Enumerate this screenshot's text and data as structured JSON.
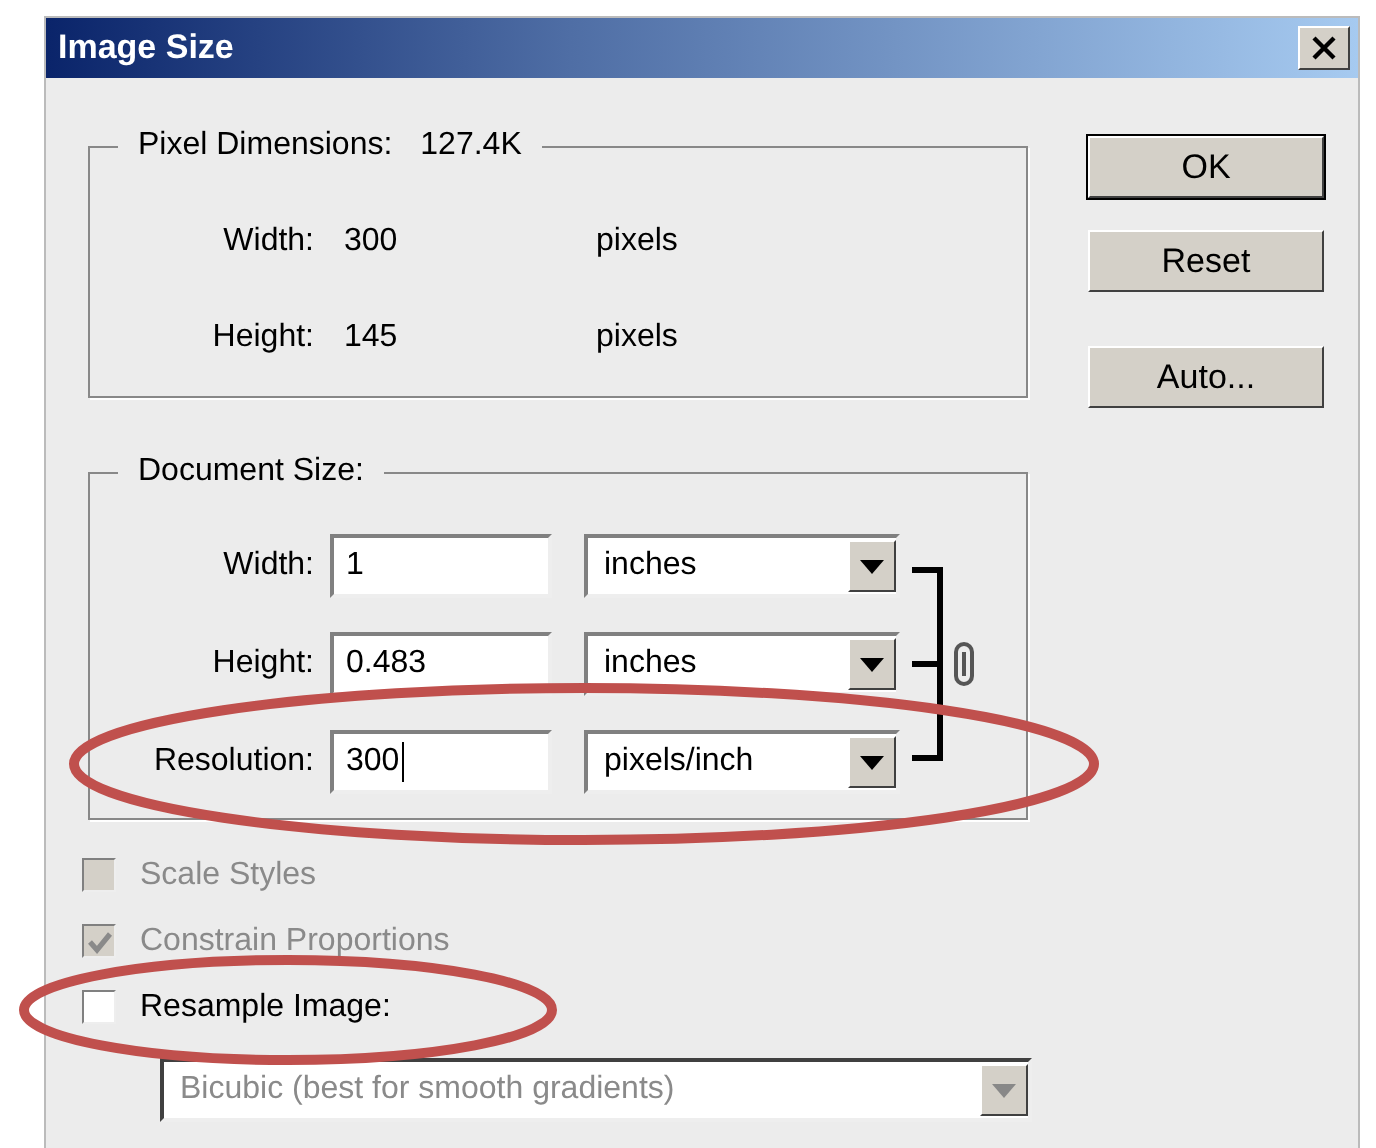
{
  "window": {
    "title": "Image Size"
  },
  "pixel_dimensions": {
    "label": "Pixel Dimensions:",
    "value": "127.4K",
    "rows": [
      {
        "label": "Width:",
        "value": "300",
        "unit": "pixels"
      },
      {
        "label": "Height:",
        "value": "145",
        "unit": "pixels"
      }
    ]
  },
  "document_size": {
    "label": "Document Size:",
    "rows": [
      {
        "label": "Width:",
        "value": "1",
        "unit": "inches",
        "focused": false
      },
      {
        "label": "Height:",
        "value": "0.483",
        "unit": "inches",
        "focused": false
      },
      {
        "label": "Resolution:",
        "value": "300",
        "unit": "pixels/inch",
        "focused": true
      }
    ]
  },
  "options": [
    {
      "label": "Scale Styles",
      "checked": false,
      "disabled": true
    },
    {
      "label": "Constrain Proportions",
      "checked": true,
      "disabled": true
    },
    {
      "label": "Resample Image:",
      "checked": false,
      "disabled": false
    }
  ],
  "resample_method": {
    "value": "Bicubic (best for smooth gradients)",
    "disabled": true
  },
  "buttons": [
    {
      "label": "OK",
      "default": true
    },
    {
      "label": "Reset",
      "default": false
    },
    {
      "label": "Auto...",
      "default": false
    }
  ]
}
